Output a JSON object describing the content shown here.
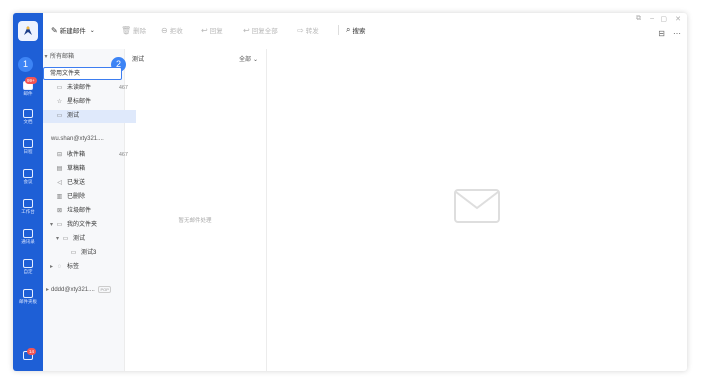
{
  "rail": {
    "mail_badge": "99+",
    "bottom_badge": "14",
    "items": [
      {
        "label": "邮件",
        "icon": "mail-icon"
      },
      {
        "label": "文档",
        "icon": "doc-icon"
      },
      {
        "label": "日程",
        "icon": "calendar-icon"
      },
      {
        "label": "会议",
        "icon": "meeting-icon"
      },
      {
        "label": "工作台",
        "icon": "grid-icon"
      },
      {
        "label": "通讯录",
        "icon": "contacts-icon"
      },
      {
        "label": "自定",
        "icon": "custom-icon"
      },
      {
        "label": "邮件夹板",
        "icon": "tool-icon"
      }
    ]
  },
  "toolbar": {
    "compose": "新建邮件",
    "delete": "删除",
    "recall": "拒收",
    "reply": "回复",
    "reply_all": "回复全部",
    "forward": "转发",
    "search": "搜索"
  },
  "folders": {
    "all_mailboxes": "所有邮箱",
    "common_folders": "常用文件夹",
    "unread": {
      "label": "未读邮件",
      "count": "467"
    },
    "starred": "星标邮件",
    "test": "测试",
    "account1": "wu.shan@xty321....",
    "inbox": {
      "label": "收件箱",
      "count": "467"
    },
    "drafts": "草稿箱",
    "sent": "已发送",
    "deleted": "已删除",
    "spam": "垃圾邮件",
    "my_folders": "我的文件夹",
    "sub_test": "测试",
    "sub_test3": "测试3",
    "tags": "标签",
    "account2": "dddd@xty321....",
    "account2_badge": "POP"
  },
  "callouts": {
    "one": "1",
    "two": "2"
  },
  "list": {
    "header": "测试",
    "filter": "全部",
    "empty": "暂无邮件处理"
  }
}
